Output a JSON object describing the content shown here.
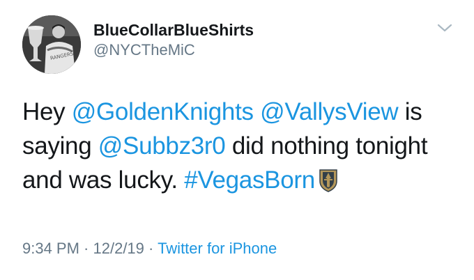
{
  "user": {
    "display_name": "BlueCollarBlueShirts",
    "handle": "@NYCTheMiC"
  },
  "tweet": {
    "words_line1": [
      "Hey ",
      "@GoldenKnights",
      " ",
      "@VallysView",
      " is"
    ],
    "text": {
      "hey": "Hey ",
      "mention1": "@GoldenKnights",
      "space1": " ",
      "mention2": "@VallysView",
      "is_saying": " is saying ",
      "mention3": "@Subbz3r0",
      "rest": " did nothing tonight and was lucky. ",
      "hashtag": "#VegasBorn"
    },
    "emoji_icon": "vegas-golden-knights-helmet-icon"
  },
  "meta": {
    "time": "9:34 PM",
    "sep1": " · ",
    "date": "12/2/19",
    "sep2": " · ",
    "source": "Twitter for iPhone"
  },
  "colors": {
    "link": "#1b95e0",
    "text": "#14171a",
    "secondary": "#657786"
  },
  "icons": {
    "avatar": "avatar",
    "caret": "chevron-down-icon"
  }
}
